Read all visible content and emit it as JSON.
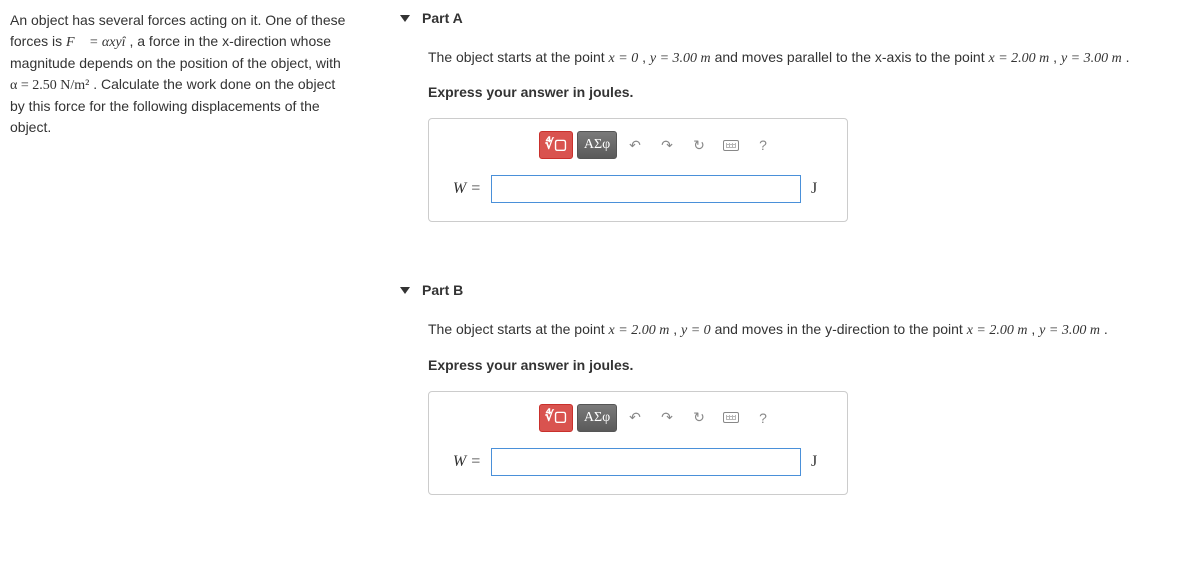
{
  "problem": {
    "text_parts": [
      "An object has several forces acting on it. One of these forces is ",
      "F⃗ = αxyî",
      ", a force in the x-direction whose magnitude depends on the position of the object, with ",
      "α = 2.50 N/m²",
      ". Calculate the work done on the object by this force for the following displacements of the object."
    ]
  },
  "parts": {
    "a": {
      "title": "Part A",
      "question_pre": "The object starts at the point ",
      "q_eq1": "x = 0",
      "q_c1": ", ",
      "q_eq2": "y = 3.00 m",
      "q_mid": " and moves parallel to the x-axis to the point ",
      "q_eq3": "x = 2.00 m",
      "q_c2": ", ",
      "q_eq4": "y = 3.00 m",
      "q_end": ".",
      "instruction": "Express your answer in joules.",
      "answer_label": "W =",
      "unit": "J"
    },
    "b": {
      "title": "Part B",
      "question_pre": "The object starts at the point ",
      "q_eq1": "x = 2.00 m",
      "q_c1": ", ",
      "q_eq2": "y = 0",
      "q_mid": " and moves in the y-direction to the point ",
      "q_eq3": "x = 2.00 m",
      "q_c2": ", ",
      "q_eq4": "y = 3.00 m",
      "q_end": ".",
      "instruction": "Express your answer in joules.",
      "answer_label": "W =",
      "unit": "J"
    }
  },
  "toolbar": {
    "equation_label": "∜▢",
    "greek_label": "ΑΣφ",
    "undo": "↶",
    "redo": "↷",
    "reset": "↻",
    "help": "?"
  }
}
